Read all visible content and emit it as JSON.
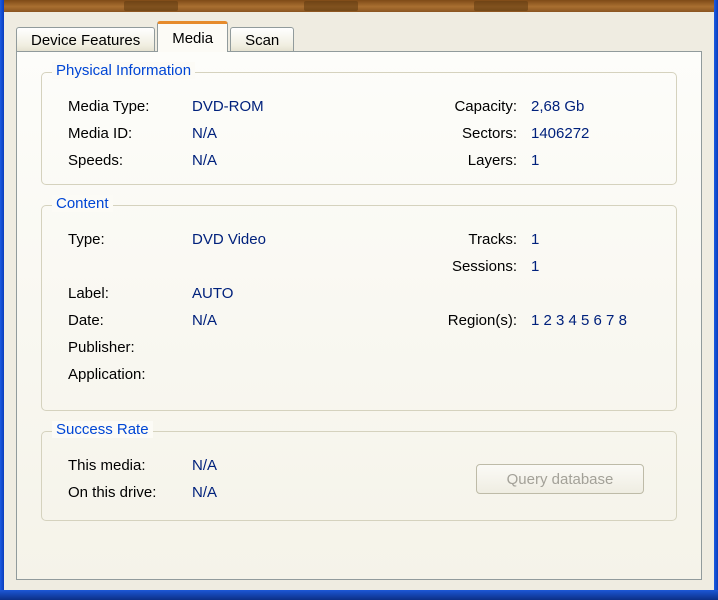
{
  "tabs": {
    "device_features": "Device Features",
    "media": "Media",
    "scan": "Scan"
  },
  "physical": {
    "title": "Physical Information",
    "rows": [
      {
        "l": "Media Type:",
        "lv": "DVD-ROM",
        "r": "Capacity:",
        "rv": "2,68 Gb"
      },
      {
        "l": "Media ID:",
        "lv": "N/A",
        "r": "Sectors:",
        "rv": "1406272"
      },
      {
        "l": "Speeds:",
        "lv": "N/A",
        "r": "Layers:",
        "rv": "1"
      }
    ]
  },
  "content": {
    "title": "Content",
    "rows": [
      {
        "l": "Type:",
        "lv": "DVD Video",
        "r": "Tracks:",
        "rv": "1"
      },
      {
        "l": "",
        "lv": "",
        "r": "Sessions:",
        "rv": "1"
      },
      {
        "l": "Label:",
        "lv": "AUTO",
        "r": "",
        "rv": ""
      },
      {
        "l": "Date:",
        "lv": "N/A",
        "r": "Region(s):",
        "rv": "1 2 3 4 5 6 7 8"
      },
      {
        "l": "Publisher:",
        "lv": "",
        "r": "",
        "rv": ""
      },
      {
        "l": "Application:",
        "lv": "",
        "r": "",
        "rv": ""
      }
    ]
  },
  "success": {
    "title": "Success Rate",
    "rows": [
      {
        "l": "This media:",
        "lv": "N/A"
      },
      {
        "l": "On this drive:",
        "lv": "N/A"
      }
    ],
    "query_button": "Query database"
  },
  "colors": {
    "group_caption": "#0046D5",
    "value_text": "#00217C",
    "active_tab_accent": "#E68B2C",
    "window_border": "#0A49D8"
  }
}
